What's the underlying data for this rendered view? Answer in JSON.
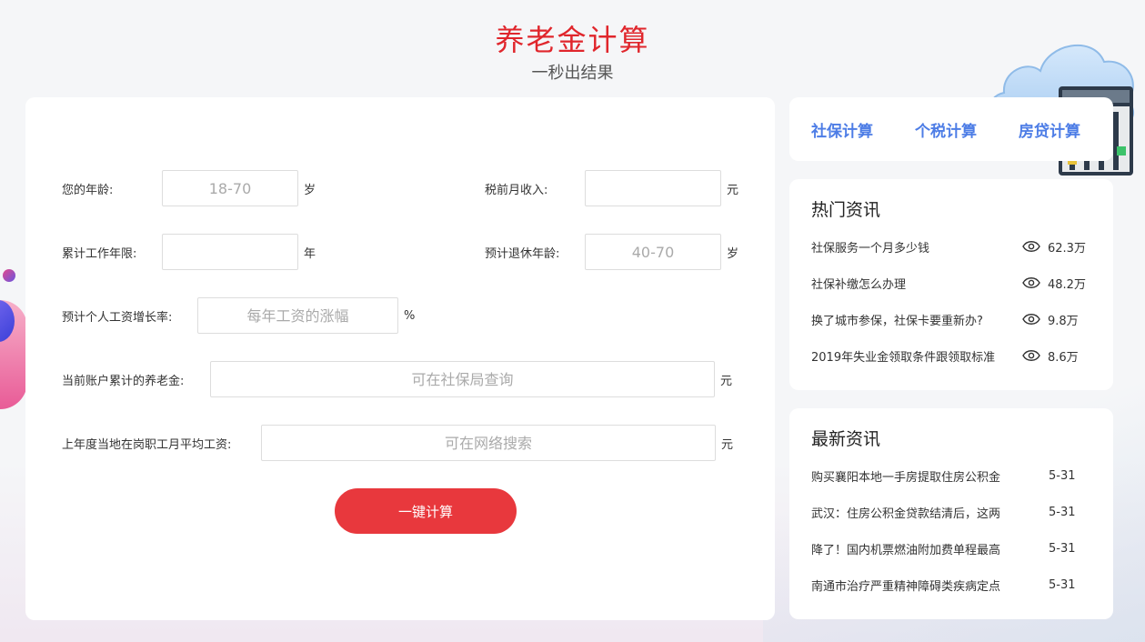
{
  "header": {
    "title": "养老金计算",
    "subtitle": "一秒出结果"
  },
  "form": {
    "age_label": "您的年龄:",
    "age_placeholder": "18-70",
    "age_unit": "岁",
    "income_label": "税前月收入:",
    "income_placeholder": "",
    "income_unit": "元",
    "years_label": "累计工作年限:",
    "years_placeholder": "",
    "years_unit": "年",
    "retire_label": "预计退休年龄:",
    "retire_placeholder": "40-70",
    "retire_unit": "岁",
    "growth_label": "预计个人工资增长率:",
    "growth_placeholder": "每年工资的涨幅",
    "growth_unit": "%",
    "balance_label": "当前账户累计的养老金:",
    "balance_placeholder": "可在社保局查询",
    "balance_unit": "元",
    "avg_label": "上年度当地在岗职工月平均工资:",
    "avg_placeholder": "可在网络搜索",
    "avg_unit": "元",
    "submit_label": "一键计算"
  },
  "links": [
    "社保计算",
    "个税计算",
    "房贷计算"
  ],
  "hot_news": {
    "title": "热门资讯",
    "items": [
      {
        "text": "社保服务一个月多少钱",
        "views": "62.3万"
      },
      {
        "text": "社保补缴怎么办理",
        "views": "48.2万"
      },
      {
        "text": "换了城市参保，社保卡要重新办?",
        "views": "9.8万"
      },
      {
        "text": "2019年失业金领取条件跟领取标准",
        "views": "8.6万"
      }
    ]
  },
  "latest_news": {
    "title": "最新资讯",
    "items": [
      {
        "text": "购买襄阳本地一手房提取住房公积金",
        "date": "5-31"
      },
      {
        "text": "武汉：住房公积金贷款结清后，这两",
        "date": "5-31"
      },
      {
        "text": "降了！国内机票燃油附加费单程最高",
        "date": "5-31"
      },
      {
        "text": "南通市治疗严重精神障碍类疾病定点",
        "date": "5-31"
      }
    ]
  },
  "colors": {
    "accent": "#e8383d",
    "title": "#e0262c",
    "link": "#4d7de6"
  },
  "icons": [
    "eye-icon",
    "cloud-icon",
    "server-icon"
  ]
}
